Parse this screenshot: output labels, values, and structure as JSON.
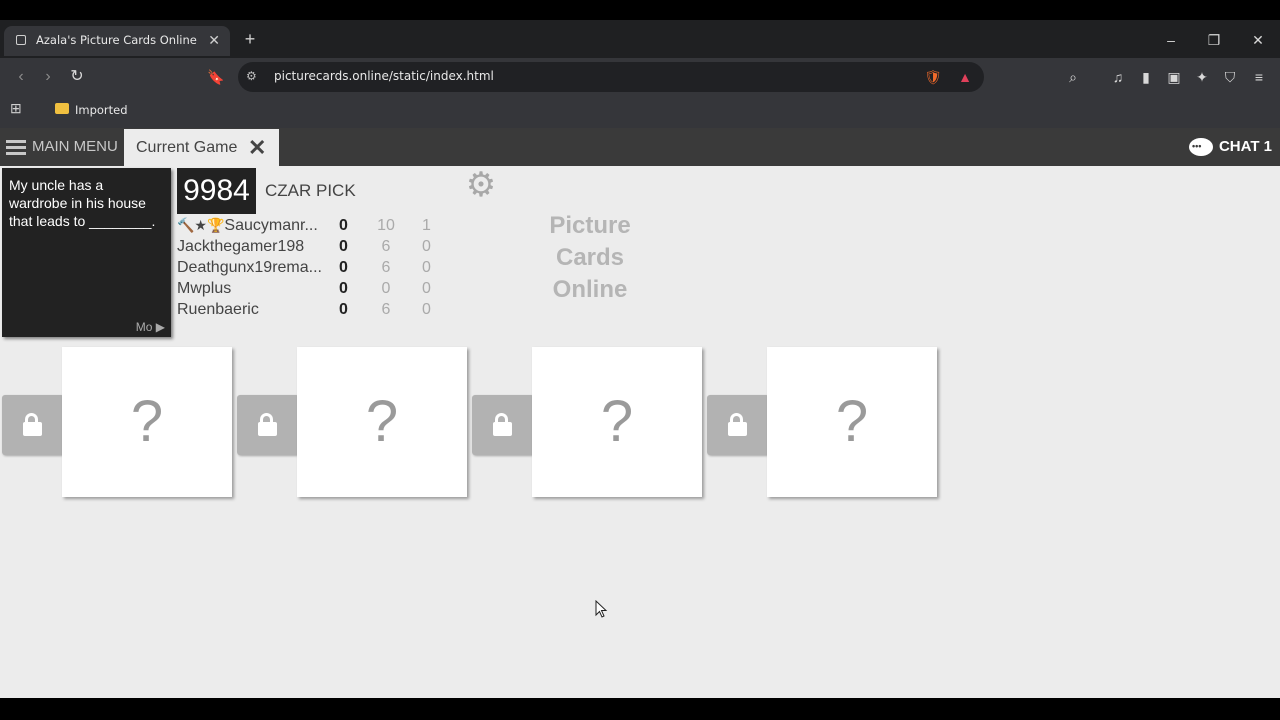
{
  "browser": {
    "tab_title": "Azala's Picture Cards Online",
    "tab_close": "✕",
    "new_tab": "+",
    "url": "picturecards.online/static/index.html",
    "bookmark_folder": "Imported",
    "window_minimize": "–",
    "window_restore": "❐",
    "window_close": "✕"
  },
  "app": {
    "main_menu_label": "MAIN MENU",
    "current_tab_label": "Current Game",
    "close_tab": "✕",
    "chat_label": "CHAT 1"
  },
  "game": {
    "black_card_text": "My uncle has a wardrobe in his house that leads to ________.",
    "more_label": "Mo ▶",
    "timer": "9984",
    "status": "CZAR PICK",
    "logo_lines": [
      "Picture",
      "Cards",
      "Online"
    ],
    "players": [
      {
        "name": "Saucymanr...",
        "badges": "🔨★🏆",
        "score": "0",
        "cards": "10",
        "extra": "1"
      },
      {
        "name": "Jackthegamer198",
        "badges": "",
        "score": "0",
        "cards": "6",
        "extra": "0"
      },
      {
        "name": "Deathgunx19rema...",
        "badges": "",
        "score": "0",
        "cards": "6",
        "extra": "0"
      },
      {
        "name": "Mwplus",
        "badges": "",
        "score": "0",
        "cards": "0",
        "extra": "0"
      },
      {
        "name": "Ruenbaeric",
        "badges": "",
        "score": "0",
        "cards": "6",
        "extra": "0"
      }
    ],
    "hidden_cards": [
      "?",
      "?",
      "?",
      "?"
    ]
  }
}
